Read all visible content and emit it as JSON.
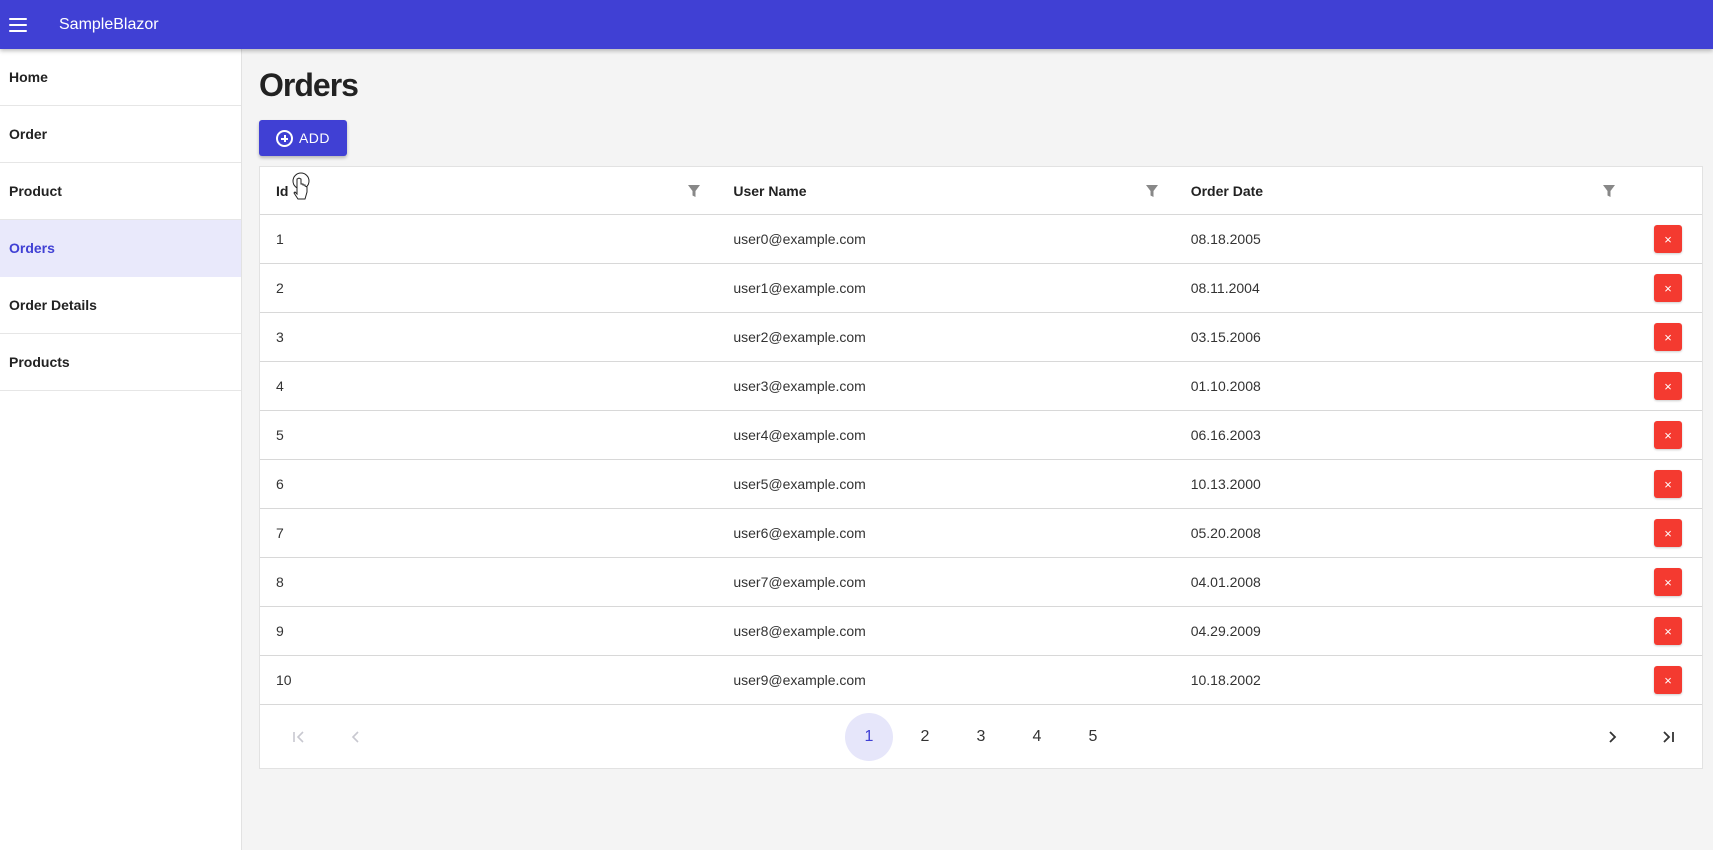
{
  "app": {
    "title": "SampleBlazor"
  },
  "sidebar": {
    "items": [
      {
        "label": "Home",
        "active": false
      },
      {
        "label": "Order",
        "active": false
      },
      {
        "label": "Product",
        "active": false
      },
      {
        "label": "Orders",
        "active": true
      },
      {
        "label": "Order Details",
        "active": false
      },
      {
        "label": "Products",
        "active": false
      }
    ]
  },
  "page": {
    "title": "Orders",
    "add_button": {
      "label": "ADD",
      "icon": "add-circle-icon"
    }
  },
  "grid": {
    "columns": [
      "Id",
      "User Name",
      "Order Date"
    ],
    "rows": [
      {
        "id": "1",
        "user": "user0@example.com",
        "date": "08.18.2005"
      },
      {
        "id": "2",
        "user": "user1@example.com",
        "date": "08.11.2004"
      },
      {
        "id": "3",
        "user": "user2@example.com",
        "date": "03.15.2006"
      },
      {
        "id": "4",
        "user": "user3@example.com",
        "date": "01.10.2008"
      },
      {
        "id": "5",
        "user": "user4@example.com",
        "date": "06.16.2003"
      },
      {
        "id": "6",
        "user": "user5@example.com",
        "date": "10.13.2000"
      },
      {
        "id": "7",
        "user": "user6@example.com",
        "date": "05.20.2008"
      },
      {
        "id": "8",
        "user": "user7@example.com",
        "date": "04.01.2008"
      },
      {
        "id": "9",
        "user": "user8@example.com",
        "date": "04.29.2009"
      },
      {
        "id": "10",
        "user": "user9@example.com",
        "date": "10.18.2002"
      }
    ],
    "delete_symbol": "×"
  },
  "pager": {
    "pages": [
      "1",
      "2",
      "3",
      "4",
      "5"
    ],
    "current_page": "1",
    "first": "|<",
    "prev": "<",
    "next": ">",
    "last": ">|"
  },
  "colors": {
    "primary": "#4040d4",
    "danger": "#f43a30",
    "active_nav_bg": "#e9e9fb"
  }
}
